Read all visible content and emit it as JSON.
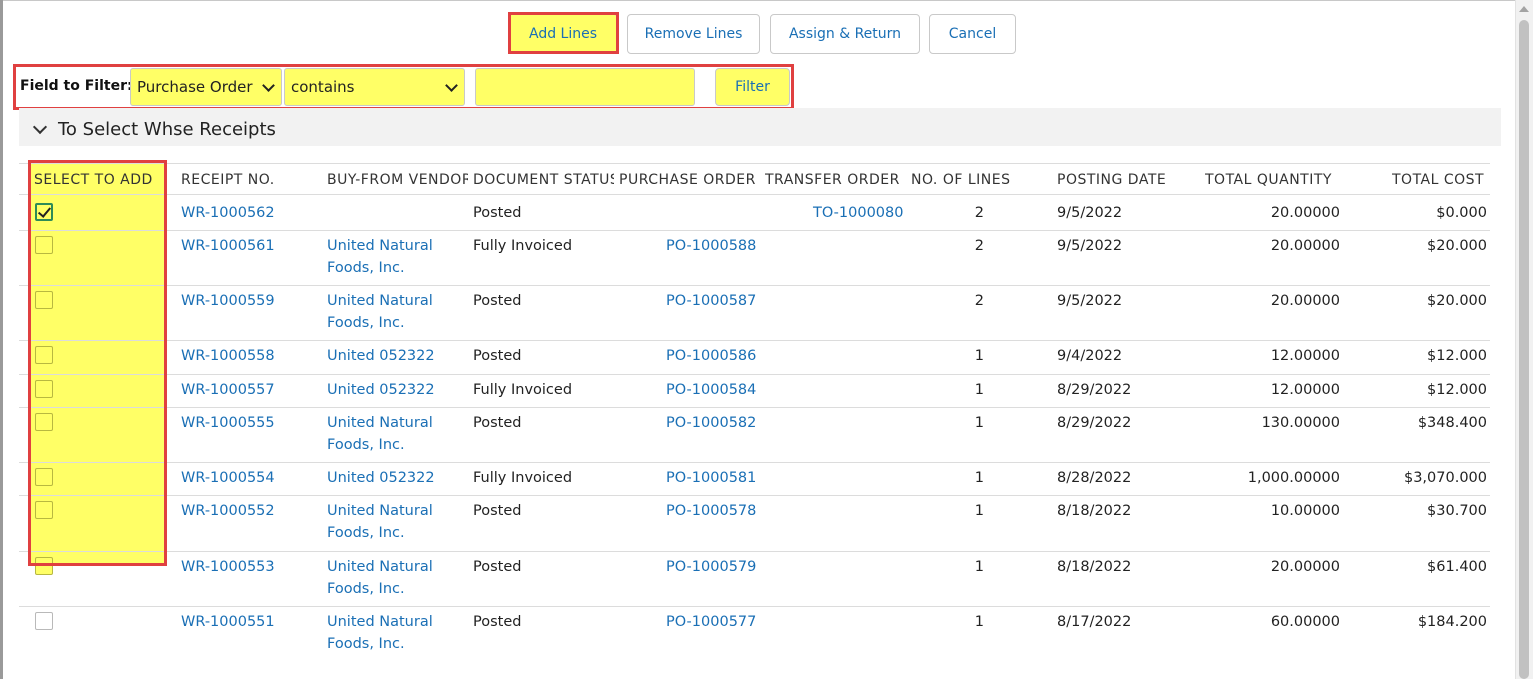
{
  "toolbar": {
    "add_lines": "Add Lines",
    "remove_lines": "Remove Lines",
    "assign_return": "Assign & Return",
    "cancel": "Cancel"
  },
  "filter": {
    "label": "Field to Filter:",
    "field": "Purchase Order",
    "operator": "contains",
    "value": "",
    "button": "Filter"
  },
  "section": {
    "title": "To Select Whse Receipts"
  },
  "columns": {
    "select": "SELECT TO ADD",
    "receipt": "RECEIPT NO.",
    "vendor": "BUY-FROM VENDOR",
    "status": "DOCUMENT STATUS",
    "po": "PURCHASE ORDER",
    "transfer": "TRANSFER ORDER",
    "lines": "NO. OF LINES",
    "date": "POSTING DATE",
    "qty": "TOTAL QUANTITY",
    "cost": "TOTAL COST"
  },
  "rows": [
    {
      "checked": true,
      "receipt": "WR-1000562",
      "vendor1": "",
      "vendor2": "",
      "status": "Posted",
      "po": "",
      "transfer": "TO-1000080",
      "lines": "2",
      "date": "9/5/2022",
      "qty": "20.00000",
      "cost": "$0.000"
    },
    {
      "checked": false,
      "receipt": "WR-1000561",
      "vendor1": "United Natural",
      "vendor2": "Foods, Inc.",
      "status": "Fully Invoiced",
      "po": "PO-1000588",
      "transfer": "",
      "lines": "2",
      "date": "9/5/2022",
      "qty": "20.00000",
      "cost": "$20.000"
    },
    {
      "checked": false,
      "receipt": "WR-1000559",
      "vendor1": "United Natural",
      "vendor2": "Foods, Inc.",
      "status": "Posted",
      "po": "PO-1000587",
      "transfer": "",
      "lines": "2",
      "date": "9/5/2022",
      "qty": "20.00000",
      "cost": "$20.000"
    },
    {
      "checked": false,
      "receipt": "WR-1000558",
      "vendor1": "United 052322",
      "vendor2": "",
      "status": "Posted",
      "po": "PO-1000586",
      "transfer": "",
      "lines": "1",
      "date": "9/4/2022",
      "qty": "12.00000",
      "cost": "$12.000"
    },
    {
      "checked": false,
      "receipt": "WR-1000557",
      "vendor1": "United 052322",
      "vendor2": "",
      "status": "Fully Invoiced",
      "po": "PO-1000584",
      "transfer": "",
      "lines": "1",
      "date": "8/29/2022",
      "qty": "12.00000",
      "cost": "$12.000"
    },
    {
      "checked": false,
      "receipt": "WR-1000555",
      "vendor1": "United Natural",
      "vendor2": "Foods, Inc.",
      "status": "Posted",
      "po": "PO-1000582",
      "transfer": "",
      "lines": "1",
      "date": "8/29/2022",
      "qty": "130.00000",
      "cost": "$348.400"
    },
    {
      "checked": false,
      "receipt": "WR-1000554",
      "vendor1": "United 052322",
      "vendor2": "",
      "status": "Fully Invoiced",
      "po": "PO-1000581",
      "transfer": "",
      "lines": "1",
      "date": "8/28/2022",
      "qty": "1,000.00000",
      "cost": "$3,070.000"
    },
    {
      "checked": false,
      "receipt": "WR-1000552",
      "vendor1": "United Natural",
      "vendor2": "Foods, Inc.",
      "status": "Posted",
      "po": "PO-1000578",
      "transfer": "",
      "lines": "1",
      "date": "8/18/2022",
      "qty": "10.00000",
      "cost": "$30.700"
    },
    {
      "checked": false,
      "receipt": "WR-1000553",
      "vendor1": "United Natural",
      "vendor2": "Foods, Inc.",
      "status": "Posted",
      "po": "PO-1000579",
      "transfer": "",
      "lines": "1",
      "date": "8/18/2022",
      "qty": "20.00000",
      "cost": "$61.400"
    },
    {
      "checked": false,
      "receipt": "WR-1000551",
      "vendor1": "United Natural",
      "vendor2": "Foods, Inc.",
      "status": "Posted",
      "po": "PO-1000577",
      "transfer": "",
      "lines": "1",
      "date": "8/17/2022",
      "qty": "60.00000",
      "cost": "$184.200"
    }
  ]
}
